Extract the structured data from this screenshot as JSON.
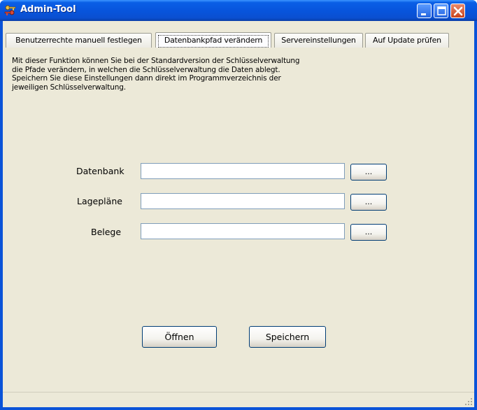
{
  "window": {
    "title": "Admin-Tool"
  },
  "tabs": [
    {
      "label": "Benutzerrechte manuell festlegen",
      "active": false
    },
    {
      "label": "Datenbankpfad verändern",
      "active": true
    },
    {
      "label": "Servereinstellungen",
      "active": false
    },
    {
      "label": "Auf Update prüfen",
      "active": false
    }
  ],
  "description": [
    "Mit dieser Funktion können Sie bei der Standardversion der Schlüsselverwaltung",
    "die Pfade verändern, in welchen die Schlüsselverwaltung die Daten ablegt.",
    "Speichern Sie diese Einstellungen dann direkt im Programmverzeichnis der",
    "jeweiligen Schlüsselverwaltung."
  ],
  "fields": [
    {
      "label": "Datenbank",
      "value": "",
      "browse_label": "..."
    },
    {
      "label": "Lagepläne",
      "value": "",
      "browse_label": "..."
    },
    {
      "label": "Belege",
      "value": "",
      "browse_label": "..."
    }
  ],
  "actions": {
    "open_label": "Öffnen",
    "save_label": "Speichern"
  },
  "colors": {
    "titlebar": "#0a53d8",
    "client": "#ece9d8",
    "close": "#c8431c"
  },
  "icons": [
    "app-icon",
    "minimize-icon",
    "maximize-icon",
    "close-icon",
    "resize-grip-icon"
  ]
}
